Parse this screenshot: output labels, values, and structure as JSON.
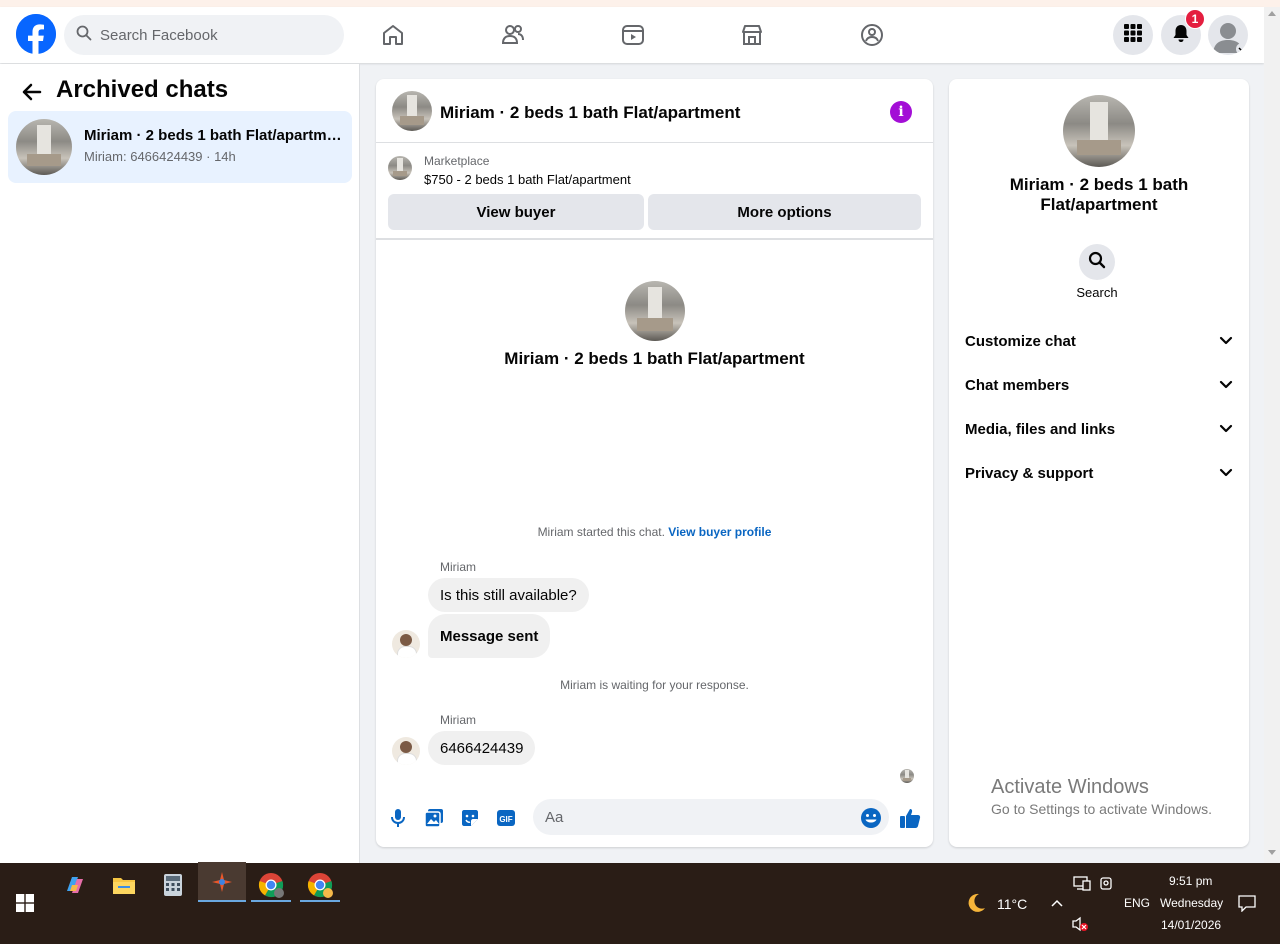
{
  "header": {
    "search_placeholder": "Search Facebook",
    "notification_count": "1"
  },
  "left_panel": {
    "title": "Archived chats",
    "chats": [
      {
        "title": "Miriam · 2 beds 1 bath Flat/apartment",
        "preview": "Miriam: 6466424439 · 14h"
      }
    ]
  },
  "chat": {
    "title": "Miriam · 2 beds 1 bath Flat/apartment",
    "marketplace": {
      "label": "Marketplace",
      "item": "$750 - 2 beds 1 bath Flat/apartment",
      "view_buyer": "View buyer",
      "more_options": "More options"
    },
    "intro_title": "Miriam · 2 beds 1 bath Flat/apartment",
    "started_text": "Miriam started this chat.",
    "view_buyer_profile": "View buyer profile",
    "messages": [
      {
        "sender": "Miriam",
        "text": "Is this still available?"
      },
      {
        "text": "Message sent"
      }
    ],
    "waiting_text": "Miriam is waiting for your response.",
    "messages2": [
      {
        "sender": "Miriam",
        "text": "6466424439"
      }
    ],
    "composer_placeholder": "Aa"
  },
  "right_panel": {
    "title": "Miriam · 2 beds 1 bath Flat/apartment",
    "search_label": "Search",
    "sections": [
      "Customize chat",
      "Chat members",
      "Media, files and links",
      "Privacy & support"
    ]
  },
  "watermark": {
    "line1": "Activate Windows",
    "line2": "Go to Settings to activate Windows."
  },
  "taskbar": {
    "temperature": "11°C",
    "language": "ENG",
    "time": "9:51 pm",
    "day": "Wednesday",
    "date": "14/01/2026"
  },
  "colors": {
    "brand": "#0866ff",
    "info": "#a30ed6",
    "link": "#0a66c2",
    "selected_chat": "#e8f2ff"
  }
}
